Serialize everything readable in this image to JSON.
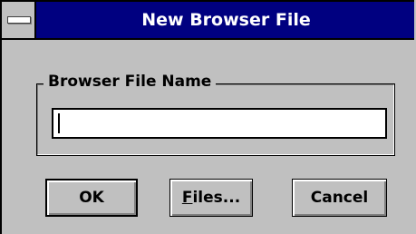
{
  "window": {
    "title": "New Browser File"
  },
  "group": {
    "label": "Browser File Name"
  },
  "file_name_input": {
    "value": ""
  },
  "buttons": {
    "ok": "OK",
    "files_mnemonic": "F",
    "files_rest": "iles...",
    "cancel": "Cancel"
  },
  "icons": {
    "system_menu": "system-menu-icon"
  }
}
